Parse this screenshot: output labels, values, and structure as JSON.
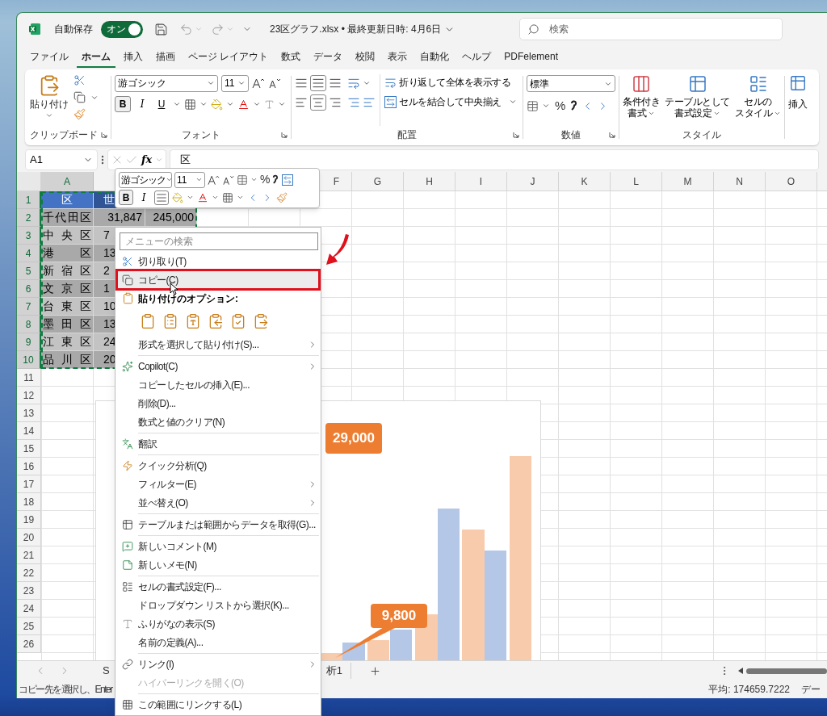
{
  "title_bar": {
    "autosave_label": "自動保存",
    "autosave_toggle": {
      "label": "オン",
      "on": true
    },
    "file_title": "23区グラフ.xlsx • 最終更新日時: 4月6日",
    "search": {
      "placeholder": "検索"
    }
  },
  "menu_tabs": [
    {
      "label": "ファイル",
      "selected": false
    },
    {
      "label": "ホーム",
      "selected": true
    },
    {
      "label": "挿入",
      "selected": false
    },
    {
      "label": "描画",
      "selected": false
    },
    {
      "label": "ページ レイアウト",
      "selected": false
    },
    {
      "label": "数式",
      "selected": false
    },
    {
      "label": "データ",
      "selected": false
    },
    {
      "label": "校閲",
      "selected": false
    },
    {
      "label": "表示",
      "selected": false
    },
    {
      "label": "自動化",
      "selected": false
    },
    {
      "label": "ヘルプ",
      "selected": false
    },
    {
      "label": "PDFelement",
      "selected": false
    }
  ],
  "ribbon": {
    "clipboard": {
      "paste_label": "貼り付け",
      "group_label": "クリップボード"
    },
    "font": {
      "font_name": "游ゴシック",
      "font_size": "11",
      "format_buttons": [
        {
          "label": "B",
          "selected": true
        },
        {
          "label": "I",
          "selected": false
        },
        {
          "label": "U",
          "selected": false
        }
      ],
      "group_label": "フォント"
    },
    "alignment": {
      "wrap_text": "折り返して全体を表示する",
      "merge_center": "セルを結合して中央揃え",
      "group_label": "配置"
    },
    "number": {
      "format": "標準",
      "percent": "%",
      "group_label": "数値"
    },
    "styles": {
      "buttons": [
        {
          "lines": [
            "条件付き",
            "書式"
          ]
        },
        {
          "lines": [
            "テーブルとして",
            "書式設定"
          ]
        },
        {
          "lines": [
            "セルの",
            "スタイル"
          ]
        }
      ],
      "group_label": "スタイル"
    },
    "cells": {
      "insert_label": "挿入"
    }
  },
  "formula_bar": {
    "name_box": "A1",
    "function_label": "fx",
    "formula": "区"
  },
  "columns": [
    {
      "label": "A",
      "selected": true
    },
    {
      "label": "F",
      "selected": false
    },
    {
      "label": "G",
      "selected": false
    },
    {
      "label": "H",
      "selected": false
    },
    {
      "label": "I",
      "selected": false
    },
    {
      "label": "J",
      "selected": false
    },
    {
      "label": "K",
      "selected": false
    },
    {
      "label": "L",
      "selected": false
    },
    {
      "label": "M",
      "selected": false
    },
    {
      "label": "N",
      "selected": false
    },
    {
      "label": "O",
      "selected": false
    }
  ],
  "rows": [
    {
      "number": "1",
      "kind": "header",
      "selected": true,
      "cells": [
        "区",
        "世"
      ]
    },
    {
      "number": "2",
      "kind": "data",
      "selected": true,
      "cells": [
        "千代田区",
        "31,847",
        "245,000"
      ]
    },
    {
      "number": "3",
      "kind": "data",
      "selected": true,
      "cells": [
        "中央区",
        "7"
      ]
    },
    {
      "number": "4",
      "kind": "data",
      "selected": true,
      "cells": [
        "港区",
        "13"
      ]
    },
    {
      "number": "5",
      "kind": "data",
      "selected": true,
      "cells": [
        "新宿区",
        "2"
      ]
    },
    {
      "number": "6",
      "kind": "data",
      "selected": true,
      "cells": [
        "文京区",
        "1"
      ]
    },
    {
      "number": "7",
      "kind": "data",
      "selected": true,
      "cells": [
        "台東区",
        "10"
      ]
    },
    {
      "number": "8",
      "kind": "data",
      "selected": true,
      "cells": [
        "墨田区",
        "13"
      ]
    },
    {
      "number": "9",
      "kind": "data",
      "selected": true,
      "cells": [
        "江東区",
        "24"
      ]
    },
    {
      "number": "10",
      "kind": "data",
      "selected": true,
      "cells": [
        "品川区",
        "20"
      ]
    },
    {
      "number": "11",
      "selected": false
    },
    {
      "number": "12",
      "selected": false
    },
    {
      "number": "13",
      "selected": false
    },
    {
      "number": "14",
      "selected": false
    },
    {
      "number": "15",
      "selected": false
    },
    {
      "number": "16",
      "selected": false
    },
    {
      "number": "17",
      "selected": false
    },
    {
      "number": "18",
      "selected": false
    },
    {
      "number": "19",
      "selected": false
    },
    {
      "number": "20",
      "selected": false
    },
    {
      "number": "21",
      "selected": false
    },
    {
      "number": "22",
      "selected": false
    },
    {
      "number": "23",
      "selected": false
    },
    {
      "number": "24",
      "selected": false
    },
    {
      "number": "25",
      "selected": false
    },
    {
      "number": "26",
      "selected": false
    }
  ],
  "chart": {
    "callouts": [
      "29,000",
      "9,800"
    ]
  },
  "mini_toolbar": {
    "font_name": "游ゴシック",
    "font_size": "11",
    "percent": "%",
    "format_buttons": [
      {
        "label": "B",
        "selected": true
      },
      {
        "label": "I",
        "selected": false
      }
    ]
  },
  "context_menu": {
    "search": {
      "placeholder": "メニューの検索"
    },
    "items": [
      {
        "kind": "item",
        "label": "切り取り(T)",
        "selected": false,
        "submenu": false,
        "disabled": false
      },
      {
        "kind": "item",
        "label": "コピー(C)",
        "selected": true,
        "submenu": false,
        "disabled": false
      },
      {
        "kind": "heading",
        "label": "貼り付けのオプション:"
      },
      {
        "kind": "paste_options"
      },
      {
        "kind": "item",
        "label": "形式を選択して貼り付け(S)...",
        "selected": false,
        "submenu": true,
        "disabled": false
      },
      {
        "kind": "separator"
      },
      {
        "kind": "item",
        "label": "Copilot(C)",
        "selected": false,
        "submenu": true,
        "disabled": false
      },
      {
        "kind": "item",
        "label": "コピーしたセルの挿入(E)...",
        "selected": false,
        "submenu": false,
        "disabled": false
      },
      {
        "kind": "item",
        "label": "削除(D)...",
        "selected": false,
        "submenu": false,
        "disabled": false
      },
      {
        "kind": "item",
        "label": "数式と値のクリア(N)",
        "selected": false,
        "submenu": false,
        "disabled": false
      },
      {
        "kind": "separator"
      },
      {
        "kind": "item",
        "label": "翻訳",
        "selected": false,
        "submenu": false,
        "disabled": false
      },
      {
        "kind": "separator"
      },
      {
        "kind": "item",
        "label": "クイック分析(Q)",
        "selected": false,
        "submenu": false,
        "disabled": false
      },
      {
        "kind": "item",
        "label": "フィルター(E)",
        "selected": false,
        "submenu": true,
        "disabled": false
      },
      {
        "kind": "item",
        "label": "並べ替え(O)",
        "selected": false,
        "submenu": true,
        "disabled": false
      },
      {
        "kind": "separator"
      },
      {
        "kind": "item",
        "label": "テーブルまたは範囲からデータを取得(G)...",
        "selected": false,
        "submenu": false,
        "disabled": false
      },
      {
        "kind": "separator"
      },
      {
        "kind": "item",
        "label": "新しいコメント(M)",
        "selected": false,
        "submenu": false,
        "disabled": false
      },
      {
        "kind": "item",
        "label": "新しいメモ(N)",
        "selected": false,
        "submenu": false,
        "disabled": false
      },
      {
        "kind": "separator"
      },
      {
        "kind": "item",
        "label": "セルの書式設定(F)...",
        "selected": false,
        "submenu": false,
        "disabled": false
      },
      {
        "kind": "item",
        "label": "ドロップダウン リストから選択(K)...",
        "selected": false,
        "submenu": false,
        "disabled": false
      },
      {
        "kind": "item",
        "label": "ふりがなの表示(S)",
        "selected": false,
        "submenu": false,
        "disabled": false
      },
      {
        "kind": "item",
        "label": "名前の定義(A)...",
        "selected": false,
        "submenu": false,
        "disabled": false
      },
      {
        "kind": "separator"
      },
      {
        "kind": "item",
        "label": "リンク(I)",
        "selected": false,
        "submenu": true,
        "disabled": false
      },
      {
        "kind": "item",
        "label": "ハイパーリンクを開く(O)",
        "selected": false,
        "submenu": false,
        "disabled": true
      },
      {
        "kind": "separator"
      },
      {
        "kind": "item",
        "label": "この範囲にリンクする(L)",
        "selected": false,
        "submenu": false,
        "disabled": false
      }
    ]
  },
  "sheet_tabs": [
    "S",
    "析1"
  ],
  "status_bar": {
    "message": "コピー先を選択し、Enter",
    "average": "平均: 174659.7222",
    "next": "デー"
  }
}
